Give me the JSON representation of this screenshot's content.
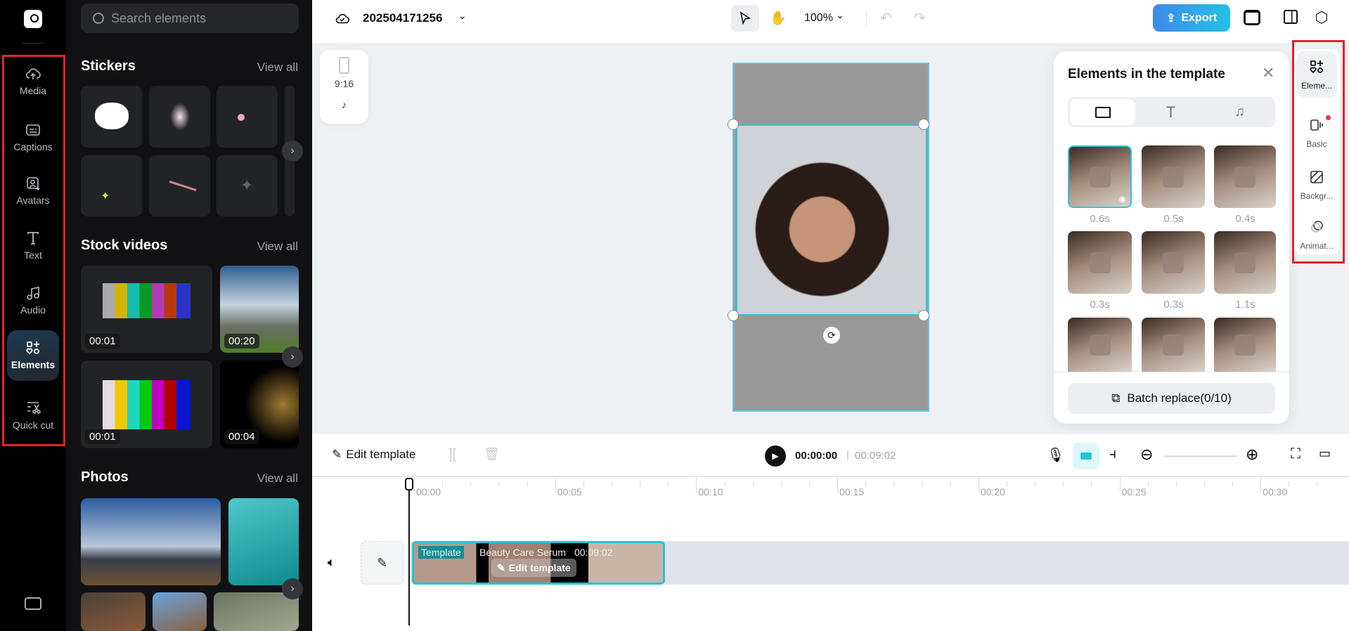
{
  "nav": {
    "items": [
      {
        "label": "Media",
        "icon": "cloud-upload-icon"
      },
      {
        "label": "Captions",
        "icon": "captions-icon"
      },
      {
        "label": "Avatars",
        "icon": "avatar-icon"
      },
      {
        "label": "Text",
        "icon": "text-icon"
      },
      {
        "label": "Audio",
        "icon": "music-icon"
      },
      {
        "label": "Elements",
        "icon": "elements-icon",
        "active": true
      },
      {
        "label": "Quick cut",
        "icon": "quick-cut-icon"
      }
    ]
  },
  "panel": {
    "search_placeholder": "Search elements",
    "stickers": {
      "title": "Stickers",
      "view_all": "View all"
    },
    "stock_videos": {
      "title": "Stock videos",
      "view_all": "View all",
      "durations": [
        "00:01",
        "00:20",
        "00:01",
        "00:04"
      ]
    },
    "photos": {
      "title": "Photos",
      "view_all": "View all"
    }
  },
  "topbar": {
    "project_name": "202504171256",
    "zoom": "100%",
    "export_label": "Export"
  },
  "canvas": {
    "aspect_ratio": "9:16"
  },
  "popup": {
    "title": "Elements in the template",
    "durations": [
      "0.6s",
      "0.5s",
      "0.4s",
      "0.3s",
      "0.3s",
      "1.1s"
    ],
    "batch_replace": "Batch replace(0/10)"
  },
  "right_strip": {
    "items": [
      "Eleme...",
      "Basic",
      "Backgr...",
      "Animat..."
    ]
  },
  "timeline": {
    "edit_template": "Edit template",
    "current_time": "00:00:00",
    "total_time": "00:09:02",
    "ruler": [
      "00:00",
      "00:05",
      "00:10",
      "00:15",
      "00:20",
      "00:25",
      "00:30"
    ],
    "clip": {
      "tag": "Template",
      "name": "Beauty Care Serum",
      "duration": "00:09:02",
      "edit_label": "Edit template"
    }
  },
  "colors": {
    "accent": "#1fc5dc",
    "export": "#2f8ff0",
    "highlight": "#e8202a"
  }
}
